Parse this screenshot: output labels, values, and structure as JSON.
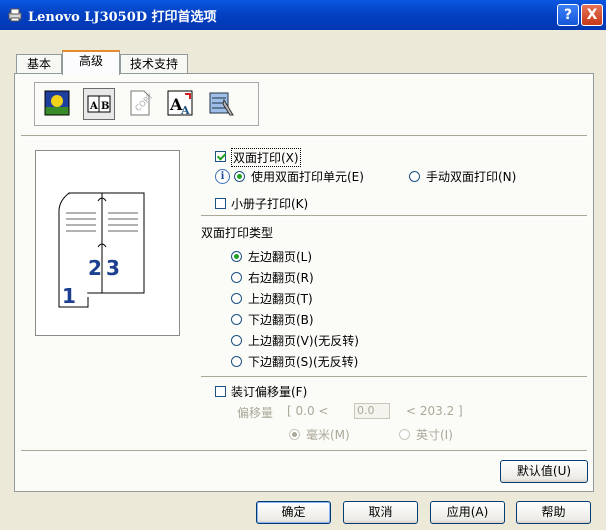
{
  "window": {
    "title": "Lenovo LJ3050D 打印首选项",
    "help_label": "?",
    "close_label": "X"
  },
  "tabs": [
    {
      "label": "基本",
      "active": false
    },
    {
      "label": "高级",
      "active": true
    },
    {
      "label": "技术支持",
      "active": false
    }
  ],
  "feature_icons": [
    "print-quality-icon",
    "duplex-icon",
    "watermark-icon",
    "page-setting-icon",
    "device-options-icon"
  ],
  "duplex": {
    "checkbox_label": "双面打印(X)",
    "checked": true,
    "use_unit_label": "使用双面打印单元(E)",
    "manual_label": "手动双面打印(N)",
    "selected_mode": "use_unit"
  },
  "booklet": {
    "label": "小册子打印(K)",
    "checked": false
  },
  "duplex_type": {
    "heading": "双面打印类型",
    "options": [
      {
        "label": "左边翻页(L)",
        "selected": true
      },
      {
        "label": "右边翻页(R)",
        "selected": false
      },
      {
        "label": "上边翻页(T)",
        "selected": false
      },
      {
        "label": "下边翻页(B)",
        "selected": false
      },
      {
        "label": "上边翻页(V)(无反转)",
        "selected": false
      },
      {
        "label": "下边翻页(S)(无反转)",
        "selected": false
      }
    ]
  },
  "binding": {
    "checkbox_label": "装订偏移量(F)",
    "checked": false,
    "offset_label": "偏移量",
    "min_text": "[  0.0 <",
    "value": "0.0",
    "max_text": "<  203.2   ]",
    "unit_mm_label": "毫米(M)",
    "unit_inch_label": "英寸(I)",
    "selected_unit": "mm"
  },
  "preview_numbers": [
    "1",
    "2",
    "3"
  ],
  "buttons": {
    "default_label": "默认值(U)",
    "ok_label": "确定",
    "cancel_label": "取消",
    "apply_label": "应用(A)",
    "help_label": "帮助"
  },
  "colors": {
    "title_bar": "#0441c3",
    "dialog_bg": "#ece9d8",
    "check_green": "#21a121"
  }
}
